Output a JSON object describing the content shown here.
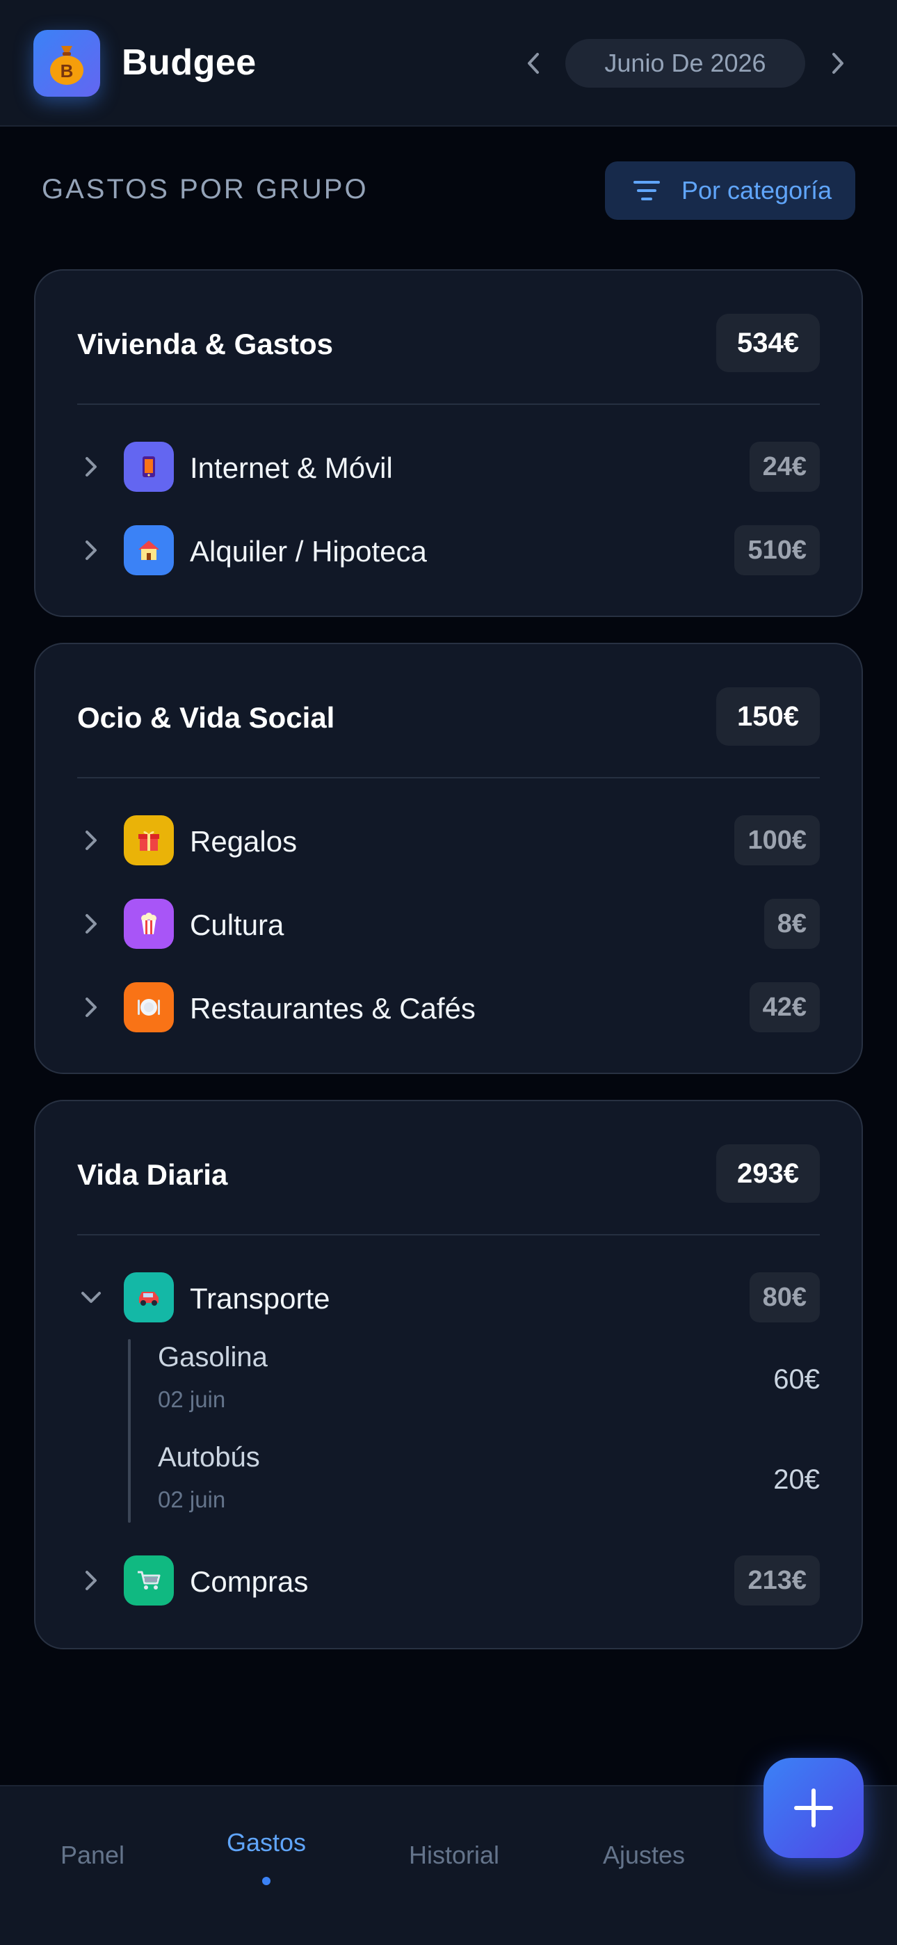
{
  "header": {
    "app_name": "Budgee",
    "logo_icon": "money-bag-icon",
    "month": "Junio De 2026"
  },
  "section": {
    "title": "GASTOS POR GRUPO",
    "filter_label": "Por categoría"
  },
  "groups": [
    {
      "name": "Vivienda & Gastos",
      "total": "534€",
      "categories": [
        {
          "name": "Internet & Móvil",
          "amount": "24€",
          "icon": "phone-icon",
          "color": "#6366f1"
        },
        {
          "name": "Alquiler / Hipoteca",
          "amount": "510€",
          "icon": "house-icon",
          "color": "#3b82f6"
        }
      ]
    },
    {
      "name": "Ocio & Vida Social",
      "total": "150€",
      "categories": [
        {
          "name": "Regalos",
          "amount": "100€",
          "icon": "gift-icon",
          "color": "#eab308"
        },
        {
          "name": "Cultura",
          "amount": "8€",
          "icon": "popcorn-icon",
          "color": "#a855f7"
        },
        {
          "name": "Restaurantes & Cafés",
          "amount": "42€",
          "icon": "plate-icon",
          "color": "#f97316"
        }
      ]
    },
    {
      "name": "Vida Diaria",
      "total": "293€",
      "categories": [
        {
          "name": "Transporte",
          "amount": "80€",
          "icon": "car-icon",
          "color": "#14b8a6",
          "expanded": true,
          "transactions": [
            {
              "name": "Gasolina",
              "date": "02 juin",
              "amount": "60€"
            },
            {
              "name": "Autobús",
              "date": "02 juin",
              "amount": "20€"
            }
          ]
        },
        {
          "name": "Compras",
          "amount": "213€",
          "icon": "cart-icon",
          "color": "#10b981"
        }
      ]
    }
  ],
  "bottom_nav": {
    "tabs": [
      "Panel",
      "Gastos",
      "Historial",
      "Ajustes"
    ],
    "active": "Gastos"
  },
  "colors": {
    "accent": "#3b82f6",
    "background": "#03060e",
    "card": "#111827"
  }
}
